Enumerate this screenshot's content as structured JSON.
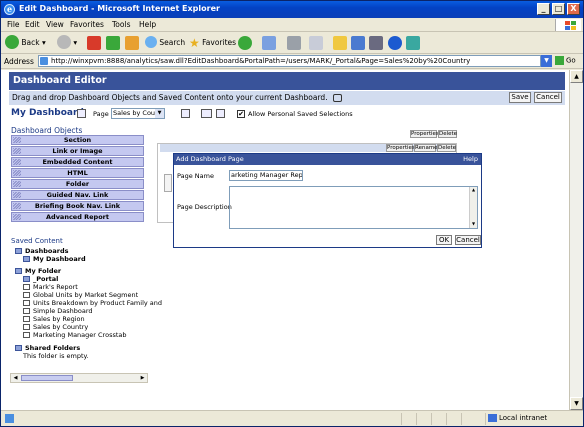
{
  "window": {
    "title": "Edit Dashboard - Microsoft Internet Explorer",
    "min": "_",
    "max": "□",
    "close": "X"
  },
  "menu": [
    "File",
    "Edit",
    "View",
    "Favorites",
    "Tools",
    "Help"
  ],
  "toolbar": {
    "back": "Back",
    "search": "Search",
    "favorites": "Favorites"
  },
  "address": {
    "label": "Address",
    "url": "http://winxpvm:8888/analytics/saw.dll?EditDashboard&PortalPath=/users/MARK/_Portal&Page=Sales%20by%20Country",
    "go": "Go"
  },
  "editor": {
    "header": "Dashboard Editor",
    "instructions": "Drag and drop Dashboard Objects and Saved Content onto your current Dashboard.",
    "save": "Save",
    "cancel": "Cancel",
    "dashboard_name": "My Dashboard",
    "page_label": "Page",
    "page_value": "Sales by Country",
    "allow_label": "Allow Personal Saved Selections",
    "allow_checked": "✔"
  },
  "objects": {
    "title": "Dashboard Objects",
    "items": [
      "Section",
      "Link or Image",
      "Embedded Content",
      "HTML",
      "Folder",
      "Guided Nav. Link",
      "Briefing Book Nav. Link",
      "Advanced Report"
    ]
  },
  "saved": {
    "title": "Saved Content",
    "dashboards": "Dashboards",
    "my_dashboard": "My Dashboard",
    "my_folder": "My Folder",
    "portal": "_Portal",
    "reports": [
      "Mark's Report",
      "Global Units by Market Segment",
      "Units Breakdown by Product Family and",
      "Simple Dashboard",
      "Sales by Region",
      "Sales by Country",
      "Marketing Manager Crosstab"
    ],
    "shared": "Shared Folders",
    "empty": "This folder is empty."
  },
  "canvas": {
    "properties": "Properties",
    "delete": "Delete",
    "rename": "Rename"
  },
  "dialog": {
    "title": "Add Dashboard Page",
    "help": "Help",
    "name_label": "Page Name",
    "name_value": "arketing Manager Reports",
    "desc_label": "Page Description",
    "ok": "OK",
    "cancel": "Cancel"
  },
  "status": {
    "zone": "Local intranet"
  },
  "colors": {
    "header": "#39539a",
    "instr": "#d2dcef",
    "object_item": "#c4c8f0"
  }
}
